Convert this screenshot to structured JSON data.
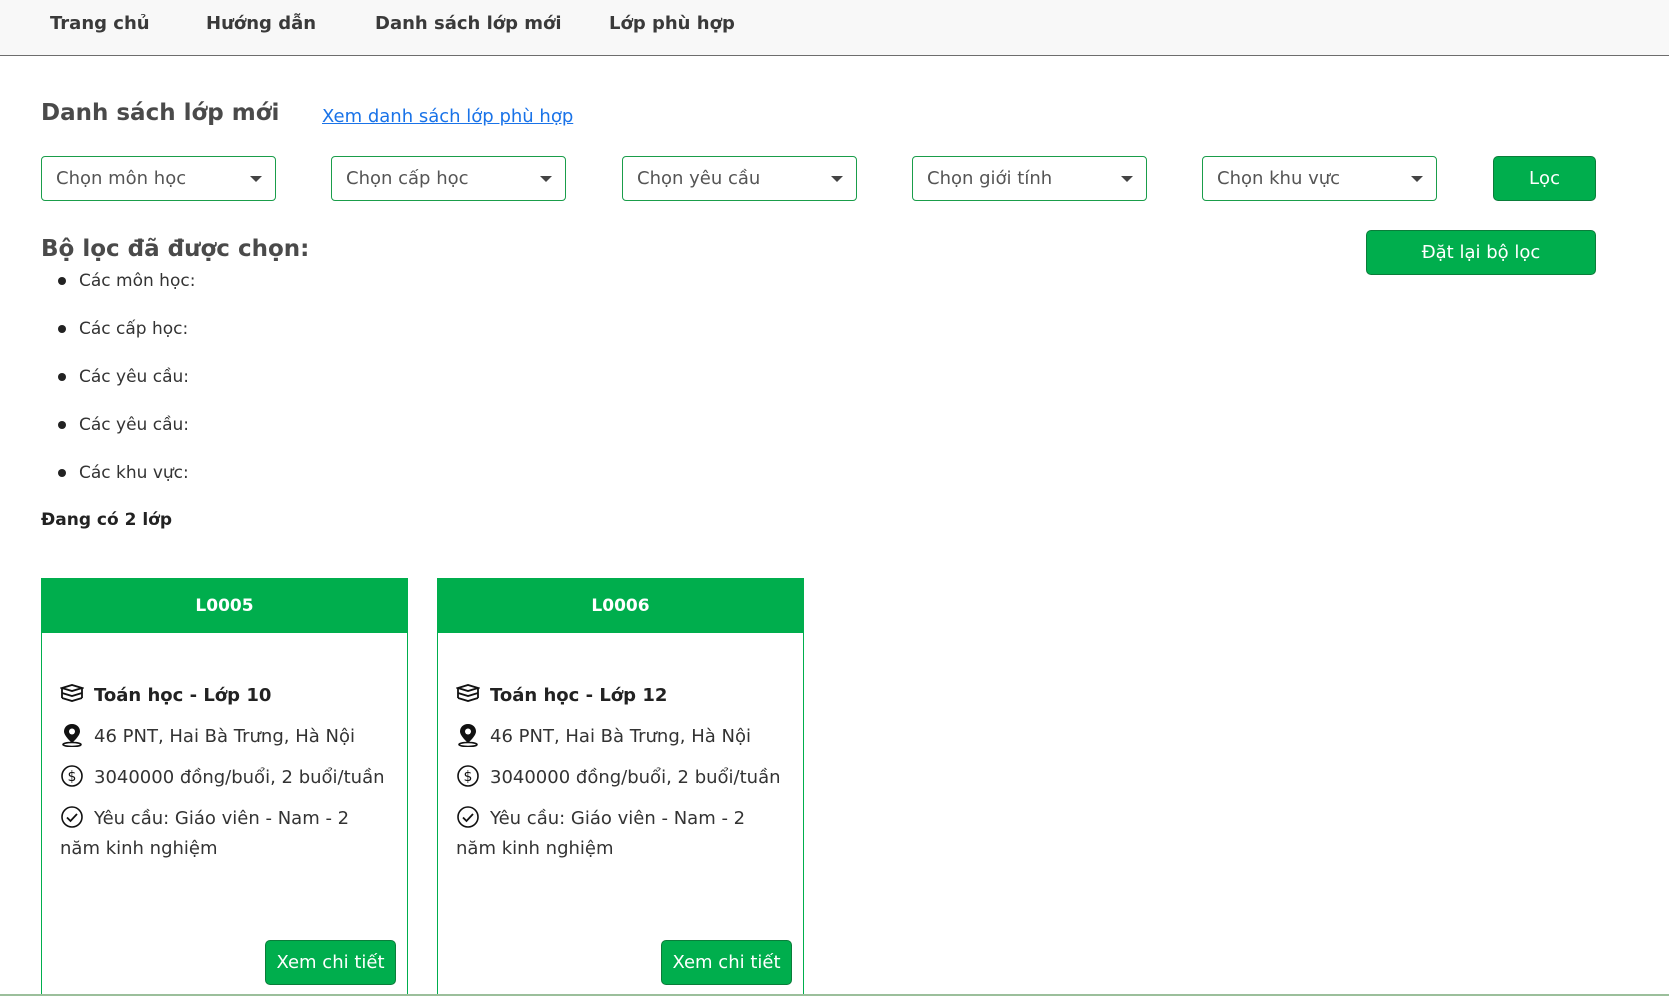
{
  "nav": {
    "items": [
      "Trang chủ",
      "Hướng dẫn",
      "Danh sách lớp mới",
      "Lớp phù hợp"
    ]
  },
  "header": {
    "title": "Danh sách lớp mới",
    "link": "Xem danh sách lớp phù hợp"
  },
  "filters": {
    "subject_placeholder": "Chọn môn học",
    "level_placeholder": "Chọn cấp học",
    "requirement_placeholder": "Chọn yêu cầu",
    "gender_placeholder": "Chọn giới tính",
    "area_placeholder": "Chọn khu vực",
    "filter_button": "Lọc",
    "reset_button": "Đặt lại bộ lọc"
  },
  "selected": {
    "title": "Bộ lọc đã được chọn:",
    "items": [
      "Các môn học:",
      "Các cấp học:",
      "Các yêu cầu:",
      "Các yêu cầu:",
      "Các khu vực:"
    ]
  },
  "count_text": "Đang có 2 lớp",
  "classes": [
    {
      "code": "L0005",
      "title": "Toán học - Lớp 10",
      "address": "46 PNT, Hai Bà Trưng, Hà Nội",
      "fee": "3040000 đồng/buổi, 2 buổi/tuần",
      "requirement": "Yêu cầu: Giáo viên - Nam - 2 năm kinh nghiệm",
      "button": "Xem chi tiết"
    },
    {
      "code": "L0006",
      "title": "Toán học - Lớp 12",
      "address": "46 PNT, Hai Bà Trưng, Hà Nội",
      "fee": "3040000 đồng/buổi, 2 buổi/tuần",
      "requirement": "Yêu cầu: Giáo viên - Nam - 2 năm kinh nghiệm",
      "button": "Xem chi tiết"
    }
  ],
  "colors": {
    "accent": "#00ae4d",
    "link": "#1a73e8"
  },
  "icons": {
    "book": "book-stack-icon",
    "location": "location-pin-icon",
    "money": "dollar-circle-icon",
    "check": "check-circle-icon",
    "caret": "caret-down-icon"
  }
}
